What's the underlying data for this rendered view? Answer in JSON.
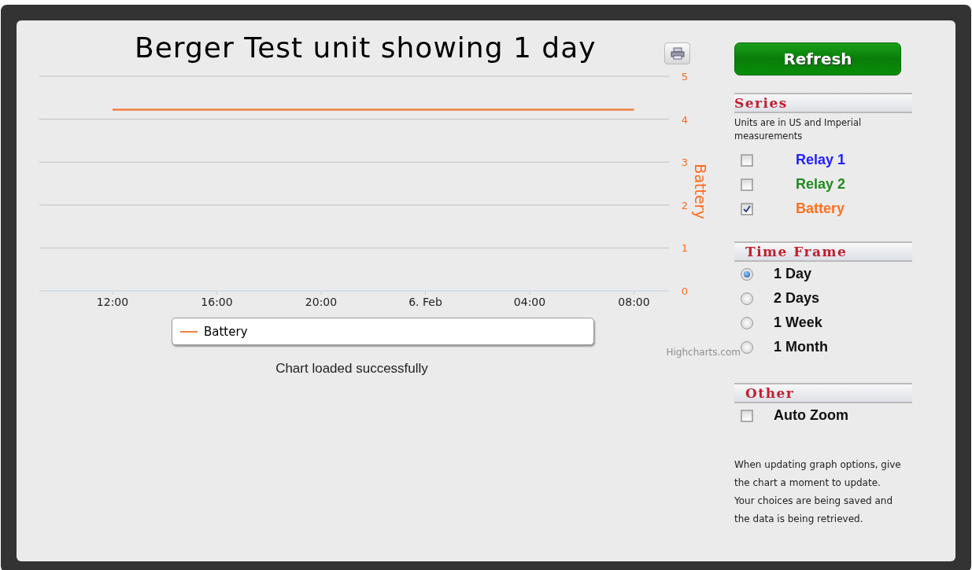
{
  "chart": {
    "title": "Berger Test unit showing 1 day",
    "chart_data": {
      "type": "line",
      "grid": true,
      "ylabel": "Battery",
      "ylim": [
        0,
        5
      ],
      "yticks": [
        0,
        1,
        2,
        3,
        4,
        5
      ],
      "categories": [
        "12:00",
        "16:00",
        "20:00",
        "6. Feb",
        "04:00",
        "08:00"
      ],
      "series": [
        {
          "name": "Battery",
          "color": "#f08040",
          "values": [
            4.22,
            4.22,
            4.22,
            4.22,
            4.22,
            4.22
          ]
        }
      ]
    },
    "credits": "Highcharts.com",
    "status": "Chart loaded successfully"
  },
  "sidebar": {
    "refresh_button": "Refresh",
    "series": {
      "heading": "Series",
      "note": "Units are in US and Imperial measurements",
      "items": [
        {
          "label": "Relay 1",
          "checked": false,
          "color": "#2020ff"
        },
        {
          "label": "Relay 2",
          "checked": false,
          "color": "#208a20"
        },
        {
          "label": "Battery",
          "checked": true,
          "color": "#ff7020"
        }
      ]
    },
    "time_frame": {
      "heading": "Time Frame",
      "options": [
        {
          "label": "1 Day",
          "selected": true
        },
        {
          "label": "2 Days",
          "selected": false
        },
        {
          "label": "1 Week",
          "selected": false
        },
        {
          "label": "1 Month",
          "selected": false
        }
      ]
    },
    "other": {
      "heading": "Other",
      "items": [
        {
          "label": "Auto Zoom",
          "checked": false
        }
      ]
    },
    "help_text": "When updating graph options, give the chart a moment to update. Your choices are being saved and the data is being retrieved."
  }
}
